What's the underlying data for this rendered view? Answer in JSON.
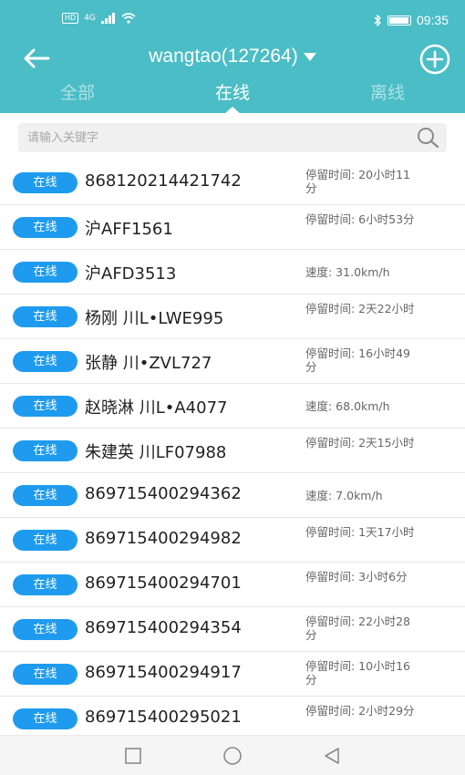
{
  "status_bar": {
    "hd": "HD",
    "network": "4G",
    "time": "09:35"
  },
  "header": {
    "title": "wangtao(127264)"
  },
  "tabs": [
    {
      "label": "全部"
    },
    {
      "label": "在线"
    },
    {
      "label": "离线"
    }
  ],
  "active_tab": "在线",
  "search": {
    "placeholder": "请输入关键字",
    "value": ""
  },
  "rows": [
    {
      "status": "在线",
      "name": "868120214421742",
      "info": "停留时间: 20小时11分"
    },
    {
      "status": "在线",
      "name": "沪AFF1561",
      "info": "停留时间: 6小时53分"
    },
    {
      "status": "在线",
      "name": "沪AFD3513",
      "info": "速度: 31.0km/h"
    },
    {
      "status": "在线",
      "name": "杨刚 川L•LWE995",
      "info": "停留时间: 2天22小时"
    },
    {
      "status": "在线",
      "name": "张静 川•ZVL727",
      "info": "停留时间: 16小时49分"
    },
    {
      "status": "在线",
      "name": "赵晓淋 川L•A4077",
      "info": "速度: 68.0km/h"
    },
    {
      "status": "在线",
      "name": "朱建英 川LF07988",
      "info": "停留时间: 2天15小时"
    },
    {
      "status": "在线",
      "name": "869715400294362",
      "info": "速度: 7.0km/h"
    },
    {
      "status": "在线",
      "name": "869715400294982",
      "info": "停留时间: 1天17小时"
    },
    {
      "status": "在线",
      "name": "869715400294701",
      "info": "停留时间: 3小时6分"
    },
    {
      "status": "在线",
      "name": "869715400294354",
      "info": "停留时间: 22小时28分"
    },
    {
      "status": "在线",
      "name": "869715400294917",
      "info": "停留时间: 10小时16分"
    },
    {
      "status": "在线",
      "name": "869715400295021",
      "info": "停留时间: 2小时29分"
    }
  ],
  "colors": {
    "header_bg": "#4bbdc6",
    "badge_bg": "#1e9bef"
  }
}
